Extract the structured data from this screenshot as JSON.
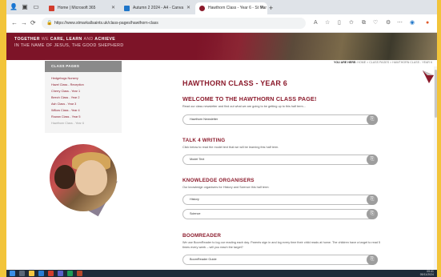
{
  "browser": {
    "tabs": [
      {
        "title": "Home | Microsoft 365",
        "active": false,
        "favicon_color": "#d23c2c"
      },
      {
        "title": "Autumn 2 2024 - A4 - Canva",
        "active": false,
        "favicon_color": "#1f76c9"
      },
      {
        "title": "Hawthorn Class - Year 6 - St Mar",
        "active": true,
        "favicon_color": "#8b1a2b"
      }
    ],
    "new_tab_symbol": "+",
    "url": "https://www.stmarkallsaints.uk/class-pages/hawthorn-class"
  },
  "banner": {
    "motto_line1_a": "TOGETHER",
    "motto_line1_b": "WE",
    "motto_line1_c": "CARE, LEARN",
    "motto_line1_d": "AND",
    "motto_line1_e": "ACHIEVE",
    "motto_line2": "IN THE NAME OF JESUS, THE GOOD SHEPHERD"
  },
  "breadcrumb": {
    "prefix": "YOU ARE HERE:",
    "path": "HOME > CLASS PAGES > HAWTHORN CLASS - YEAR 6"
  },
  "sidebar": {
    "heading": "CLASS PAGES",
    "items": [
      "Hedgehogs Nursery",
      "Hazel Class - Reception",
      "Cherry Class - Year 1",
      "Beech Class - Year 2",
      "Ash Class - Year 3",
      "Willow Class - Year 4",
      "Rowan Class - Year 5",
      "Hawthorn Class - Year 6"
    ]
  },
  "main": {
    "title": "HAWTHORN CLASS - YEAR 6",
    "welcome_heading": "WELCOME TO THE HAWTHORN CLASS PAGE!",
    "welcome_text": "Read our class newsletter and find out what we are going to be getting up to this half term...",
    "newsletter_label": "Hawthorn Newsletter",
    "talk_heading": "TALK 4 WRITING",
    "talk_text": "Click below to read the model text that we will be learning this half term.",
    "model_text_label": "Model Text",
    "ko_heading": "KNOWLEDGE ORGANISERS",
    "ko_text": "Our knowledge organisers for History and Science this half term:",
    "history_label": "History",
    "science_label": "Science",
    "boom_heading": "BOOMREADER",
    "boom_text": "We use BoomReader to log our reading each day. Parents sign in and log every time their child reads at home. The children have a target to read 5 times every week – will you reach the target?",
    "boom_guide_label": "BoomReader Guide"
  },
  "taskbar": {
    "time": "09:41",
    "date": "05/11/2024"
  },
  "colors": {
    "brand": "#8b1a2b",
    "desktop_border": "#f2c43a"
  }
}
